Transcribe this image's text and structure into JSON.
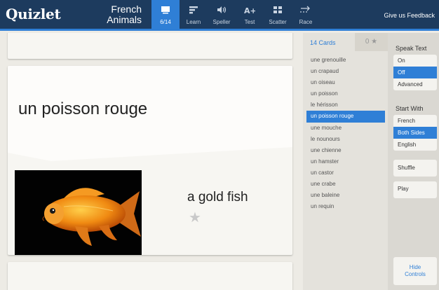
{
  "header": {
    "logo": "Quizlet",
    "set_title_line1": "French",
    "set_title_line2": "Animals",
    "feedback": "Give us Feedback",
    "modes": [
      {
        "label": "6/14",
        "icon": "cards-icon"
      },
      {
        "label": "Learn",
        "icon": "learn-icon"
      },
      {
        "label": "Speller",
        "icon": "speaker-icon"
      },
      {
        "label": "Test",
        "icon": "test-icon"
      },
      {
        "label": "Scatter",
        "icon": "scatter-icon"
      },
      {
        "label": "Race",
        "icon": "race-icon"
      }
    ]
  },
  "card": {
    "term": "un poisson rouge",
    "definition": "a gold fish",
    "star": "★"
  },
  "list": {
    "count_label": "14 Cards",
    "star_count": "0 ★",
    "words": [
      "une grenouille",
      "un crapaud",
      "un oiseau",
      "un poisson",
      "le hérisson",
      "un poisson rouge",
      "une mouche",
      "le nounours",
      "une chienne",
      "un hamster",
      "un castor",
      "une crabe",
      "une baleine",
      "un requin"
    ]
  },
  "controls": {
    "speak_text_title": "Speak Text",
    "speak_options": [
      "On",
      "Off",
      "Advanced"
    ],
    "start_with_title": "Start With",
    "start_options": [
      "French",
      "Both Sides",
      "English"
    ],
    "shuffle": "Shuffle",
    "play": "Play",
    "hide_line1": "Hide",
    "hide_line2": "Controls"
  },
  "colors": {
    "header_bg": "#1d3b5e",
    "accent": "#2f7fd6",
    "page_bg": "#edebe5"
  }
}
